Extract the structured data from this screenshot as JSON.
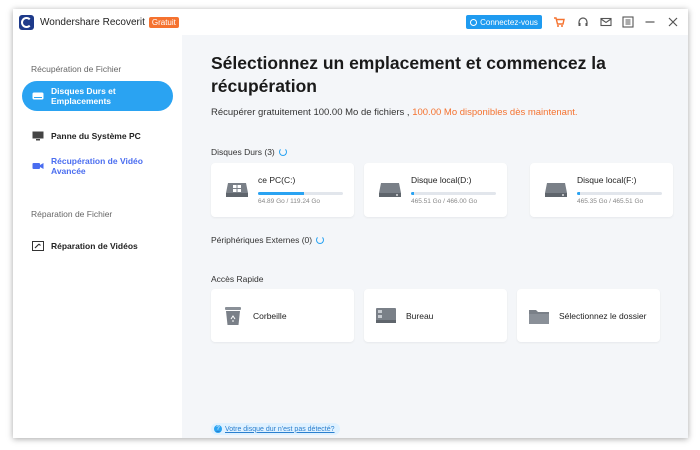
{
  "app": {
    "name": "Wondershare Recoverit",
    "badge": "Gratuit",
    "connect_label": "Connectez-vous"
  },
  "sidebar": {
    "section1": "Récupération de Fichier",
    "items": [
      {
        "label": "Disques Durs et Emplacements",
        "icon": "hard-drive-icon"
      },
      {
        "label": "Panne du Système PC",
        "icon": "monitor-icon"
      },
      {
        "label": "Récupération de Vidéo Avancée",
        "icon": "video-camera-icon"
      }
    ],
    "section2": "Réparation de Fichier",
    "items2": [
      {
        "label": "Réparation de Vidéos",
        "icon": "video-repair-icon"
      }
    ]
  },
  "main": {
    "title": "Sélectionnez un emplacement et commencez la récupération",
    "subtitle": "Récupérer gratuitement 100.00 Mo de fichiers , ",
    "subtitle_accent": "100.00 Mo disponibles dès maintenant.",
    "drives_label": "Disques Durs (3)",
    "drives": [
      {
        "name": "ce PC(C:)",
        "size": "64.89 Go / 119.24 Go",
        "used_fraction": 0.544
      },
      {
        "name": "Disque local(D:)",
        "size": "465.51 Go / 466.00 Go",
        "used_fraction": 0.03
      },
      {
        "name": "Disque local(F:)",
        "size": "465.35 Go / 465.51 Go",
        "used_fraction": 0.03
      }
    ],
    "external_label": "Périphériques Externes (0)",
    "quick_label": "Accès Rapide",
    "quick": [
      {
        "label": "Corbeille",
        "icon": "recycle-bin-icon"
      },
      {
        "label": "Bureau",
        "icon": "desktop-icon"
      },
      {
        "label": "Sélectionnez le dossier",
        "icon": "folder-icon"
      }
    ],
    "help_link": "Votre disque dur n'est pas détecté?"
  },
  "colors": {
    "accent_blue": "#2aa3f2",
    "accent_orange": "#f5722f"
  }
}
